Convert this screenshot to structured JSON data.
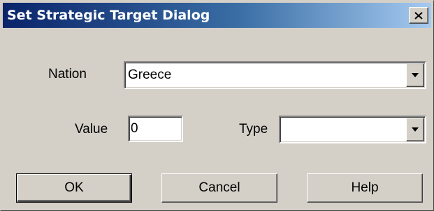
{
  "window": {
    "title": "Set Strategic Target Dialog",
    "close_icon": "close-icon"
  },
  "form": {
    "nation_label": "Nation",
    "nation_value": "Greece",
    "value_label": "Value",
    "value_value": "0",
    "type_label": "Type",
    "type_value": ""
  },
  "buttons": {
    "ok": "OK",
    "cancel": "Cancel",
    "help": "Help"
  },
  "colors": {
    "face": "#d4d0c8",
    "title_start": "#0a246a",
    "title_end": "#a6caf0"
  }
}
